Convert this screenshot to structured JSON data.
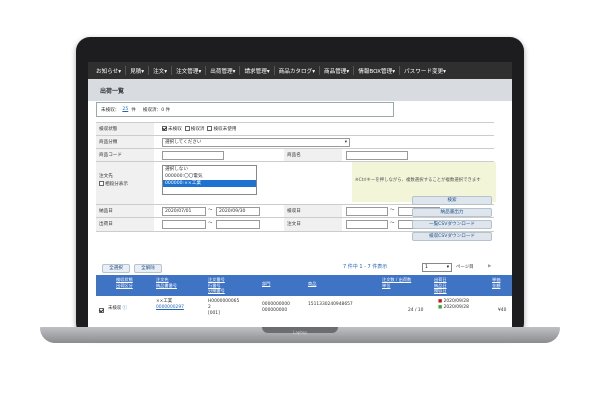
{
  "nav": [
    "お知らせ▾",
    "見積▾",
    "注文▾",
    "注文管理▾",
    "出荷管理▾",
    "請求管理▾",
    "商品カタログ▾",
    "商品管理▾",
    "情報BOX管理▾",
    "パスワード変更▾"
  ],
  "page_title": "出荷一覧",
  "summary": {
    "unshipped_label": "未検収：",
    "unshipped_count": "25",
    "unit": "件",
    "inspected_label": "検収済：0 件"
  },
  "form": {
    "status_label": "検収状態",
    "status_options": [
      "未検収",
      "検収済",
      "検収未使用"
    ],
    "category_label": "商品分類",
    "category_placeholder": "選択してください",
    "code_label": "商品コード",
    "name_label": "商品名",
    "dest_label": "注文先",
    "dest_sub_label": "相殺分表示",
    "dest_options": [
      "選択しない",
      "000000:〇〇電気",
      "000000:××工業"
    ],
    "hint": "※Ctrlキーを押しながら、複数選択することが複数選択できます",
    "ship_date_label": "納品日",
    "date_from": "2020/07/01",
    "date_to": "2020/09/30",
    "inspect_date_label": "検収日",
    "out_date_label": "出荷日",
    "order_date_label": "注文日",
    "tilde": "〜"
  },
  "side_buttons": [
    "検索",
    "納品書出力",
    "一覧CSVダウンロード",
    "検収CSVダウンロード"
  ],
  "select_all": "全選択",
  "deselect_all": "全解除",
  "count_text": "7 件中 1 - 7 件表示",
  "page": {
    "value": "1",
    "label": "ページ目"
  },
  "table": {
    "headers": [
      [
        "検収状態",
        "出荷区分"
      ],
      [
        "注文先",
        "納品書番号"
      ],
      [
        "注文番号",
        "行番号",
        "分納番号"
      ],
      [
        "部門"
      ],
      [
        "商品"
      ],
      [
        "注文数 / 出荷数",
        "単位"
      ],
      [
        "出荷日",
        "納品日",
        "検収日"
      ],
      [
        "単価",
        "金額"
      ]
    ],
    "row": {
      "status": "未検収",
      "vendor": "××工業",
      "slip_no": "0000000297",
      "order_no": "H0000000065",
      "line_no": "2",
      "split_no": "[001]",
      "dept": "0000000000",
      "dept2": "000000000",
      "product": "1511330240948657",
      "qty": "24 / 10",
      "ship_date": "2020/09/28",
      "deliv_date": "2020/09/28",
      "price": "¥40"
    }
  },
  "laptop_label": "Laptop"
}
